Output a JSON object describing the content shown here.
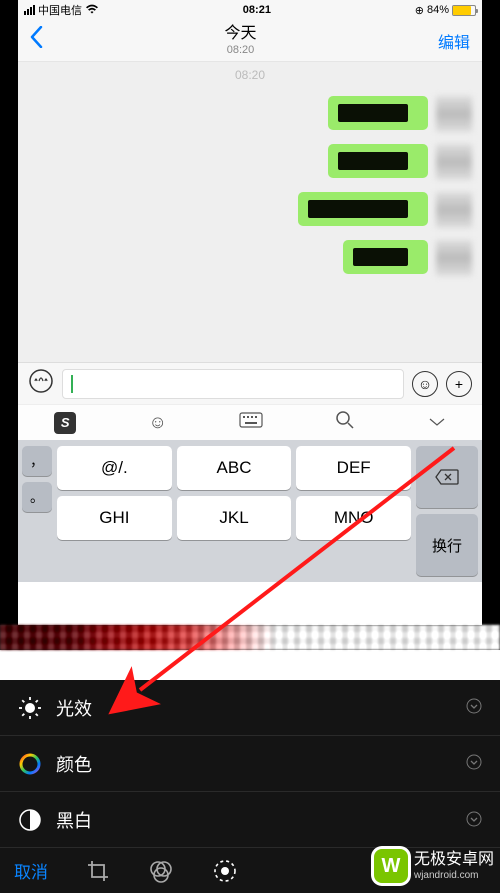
{
  "status_bar": {
    "carrier": "中国电信",
    "time": "08:21",
    "battery_percent": "84%"
  },
  "nav": {
    "title": "今天",
    "subtitle": "08:20",
    "edit_label": "编辑"
  },
  "chat": {
    "timestamp": "08:20"
  },
  "keyboard": {
    "keys": {
      "comma": "，",
      "period": "。",
      "at": "@/.",
      "abc": "ABC",
      "def": "DEF",
      "ghi": "GHI",
      "jkl": "JKL",
      "mno": "MNO",
      "linebreak": "换行"
    }
  },
  "edit_panel": {
    "rows": [
      {
        "label": "光效"
      },
      {
        "label": "颜色"
      },
      {
        "label": "黑白"
      }
    ]
  },
  "bottom_bar": {
    "cancel": "取消"
  },
  "watermark": {
    "logo_letter": "W",
    "line1": "无极安卓网",
    "line2": "wjandroid.com"
  }
}
